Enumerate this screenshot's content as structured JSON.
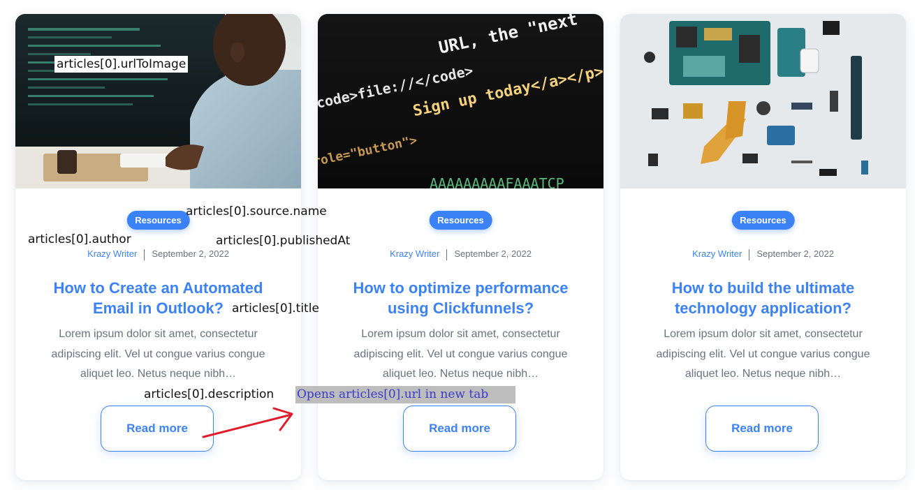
{
  "articles": [
    {
      "badge": "Resources",
      "author": "Krazy Writer",
      "date": "September 2, 2022",
      "title": "How to Create an Automated Email in Outlook?",
      "description": "Lorem ipsum dolor sit amet, consectetur adipiscing elit. Vel ut congue varius congue aliquet leo. Netus neque nibh…",
      "button": "Read more",
      "image_icon": "person-at-computer-photo"
    },
    {
      "badge": "Resources",
      "author": "Krazy Writer",
      "date": "September 2, 2022",
      "title": "How to optimize performance using Clickfunnels?",
      "description": "Lorem ipsum dolor sit amet, consectetur adipiscing elit. Vel ut congue varius congue aliquet leo. Netus neque nibh…",
      "button": "Read more",
      "image_icon": "code-screen-photo"
    },
    {
      "badge": "Resources",
      "author": "Krazy Writer",
      "date": "September 2, 2022",
      "title": "How to build the ultimate technology application?",
      "description": "Lorem ipsum dolor sit amet, consectetur adipiscing elit. Vel ut congue varius congue aliquet leo. Netus neque nibh…",
      "button": "Read more",
      "image_icon": "phone-parts-photo"
    }
  ],
  "code_lines": {
    "line1": "URL, the \"next",
    "line2": "<code>file://</code>",
    "line3": "Sign up today</a></p>",
    "line4": "role=\"button\">",
    "line5": "AAAAAAAAAFAAATCP"
  },
  "annotations": {
    "url_to_image": "articles[0].urlToImage",
    "source_name": "articles[0].source.name",
    "author": "articles[0].author",
    "published_at": "articles[0].publishedAt",
    "title": "articles[0].title",
    "description": "articles[0].description",
    "url": "Opens articles[0].url in new tab"
  },
  "colors": {
    "accent": "#3b82f6",
    "muted_text": "#6b7280",
    "annotation_arrow": "#e11d2a",
    "annotation_link": "#3b3bcf"
  }
}
